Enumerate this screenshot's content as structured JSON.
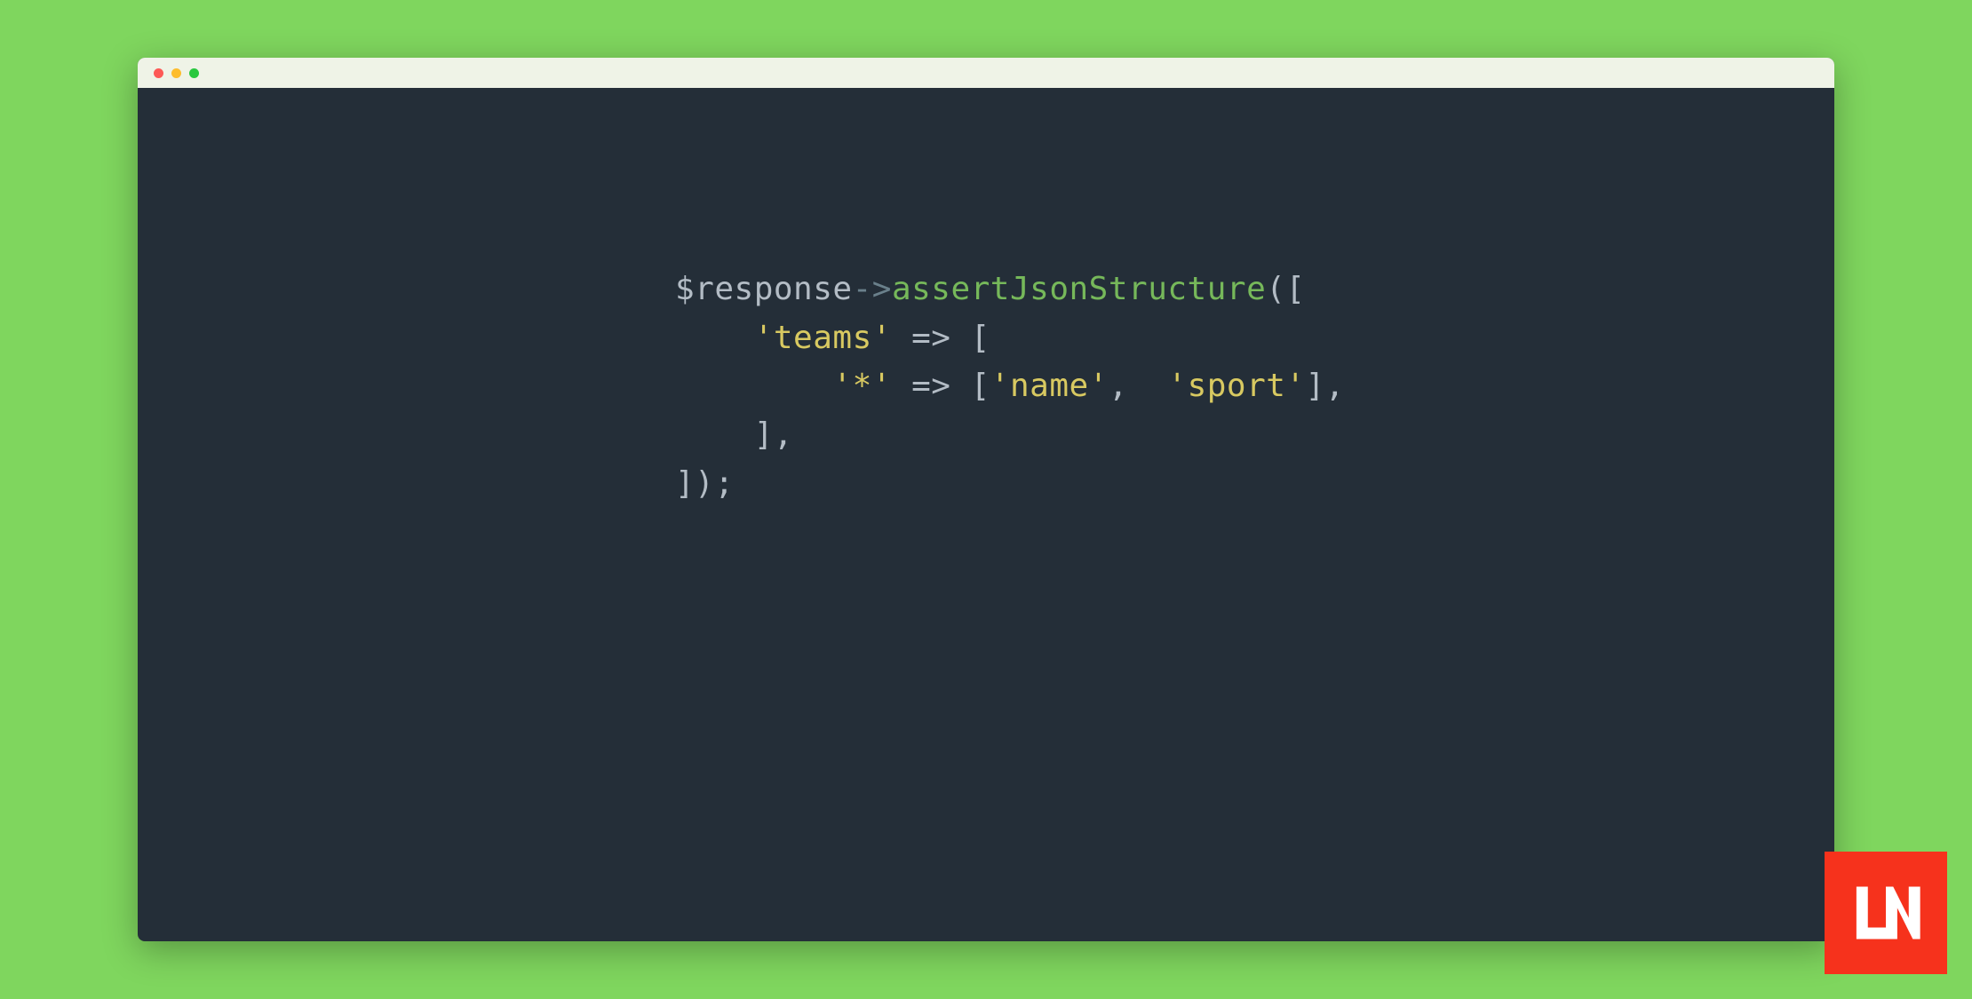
{
  "code": {
    "line1": {
      "variable": "$response",
      "arrow": "->",
      "method": "assertJsonStructure",
      "paren_open": "([",
      "after": ""
    },
    "line2": {
      "indent": "    ",
      "string": "'teams'",
      "arrow": " => ",
      "bracket": "["
    },
    "line3": {
      "indent": "        ",
      "string1": "'*'",
      "arrow": " => ",
      "bracket_open": "[",
      "string2": "'name'",
      "comma": ",  ",
      "string3": "'sport'",
      "bracket_close": "],"
    },
    "line4": {
      "indent": "    ",
      "bracket": "],"
    },
    "line5": {
      "text": "]);"
    }
  },
  "logo": {
    "name": "LN"
  }
}
